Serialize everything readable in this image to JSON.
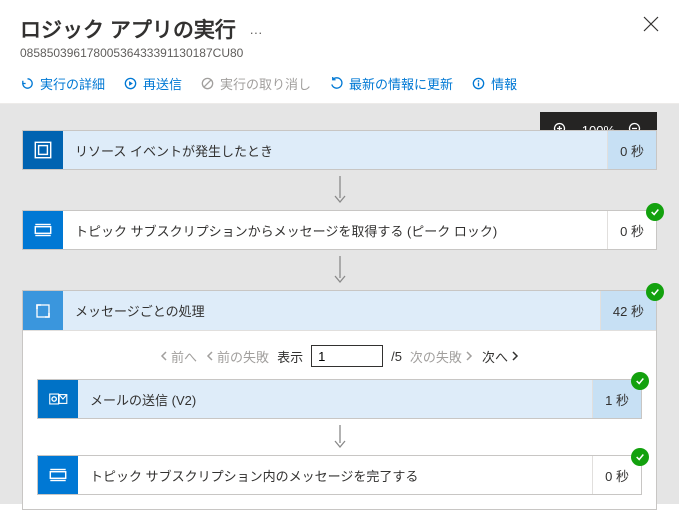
{
  "header": {
    "title": "ロジック アプリの実行",
    "subtitle": "08585039617800536433391130187CU80"
  },
  "toolbar": {
    "details": "実行の詳細",
    "resubmit": "再送信",
    "cancel": "実行の取り消し",
    "refresh": "最新の情報に更新",
    "info": "情報"
  },
  "zoom": {
    "level": "100%"
  },
  "steps": {
    "trigger": {
      "label": "リソース イベントが発生したとき",
      "duration": "0 秒"
    },
    "get_message": {
      "label": "トピック サブスクリプションからメッセージを取得する (ピーク ロック)",
      "duration": "0 秒"
    },
    "foreach": {
      "label": "メッセージごとの処理",
      "duration": "42 秒",
      "pager": {
        "prev": "前へ",
        "prev_fail": "前の失敗",
        "show_label": "表示",
        "value": "1",
        "total": "/5",
        "next_fail": "次の失敗",
        "next": "次へ"
      },
      "send_mail": {
        "label": "メールの送信 (V2)",
        "duration": "1 秒"
      },
      "complete": {
        "label": "トピック サブスクリプション内のメッセージを完了する",
        "duration": "0 秒"
      }
    }
  }
}
